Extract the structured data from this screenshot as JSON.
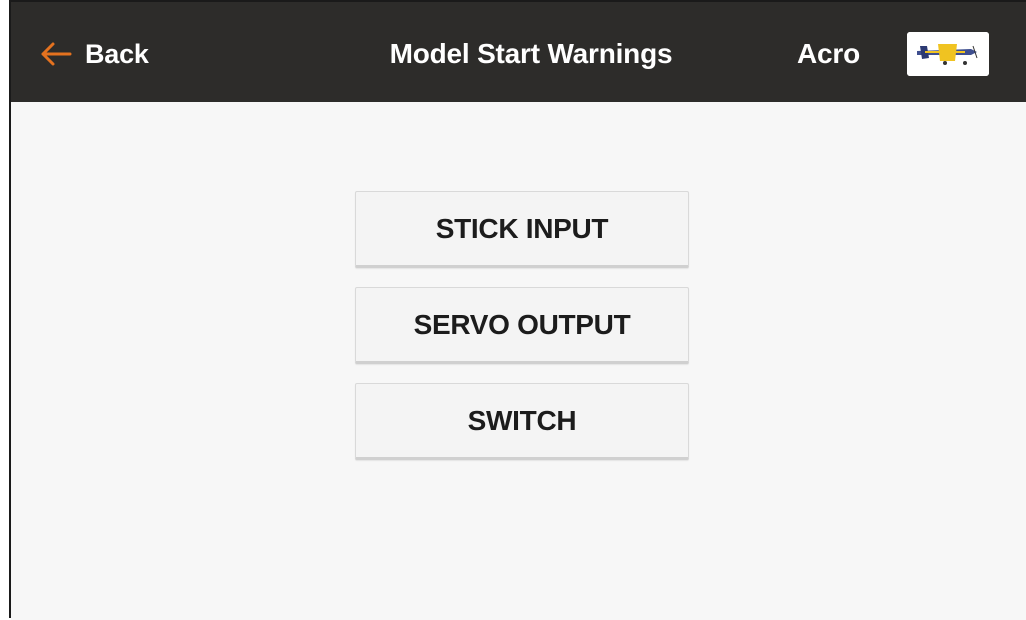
{
  "header": {
    "back_label": "Back",
    "title": "Model Start Warnings",
    "model_name": "Acro"
  },
  "options": [
    {
      "label": "STICK INPUT"
    },
    {
      "label": "SERVO OUTPUT"
    },
    {
      "label": "SWITCH"
    }
  ],
  "icons": {
    "back": "arrow-left-icon",
    "model": "airplane-thumbnail-icon"
  },
  "colors": {
    "header_bg": "#2d2c2a",
    "accent": "#e4721f",
    "content_bg": "#f7f7f7",
    "button_bg": "#f4f4f4"
  }
}
